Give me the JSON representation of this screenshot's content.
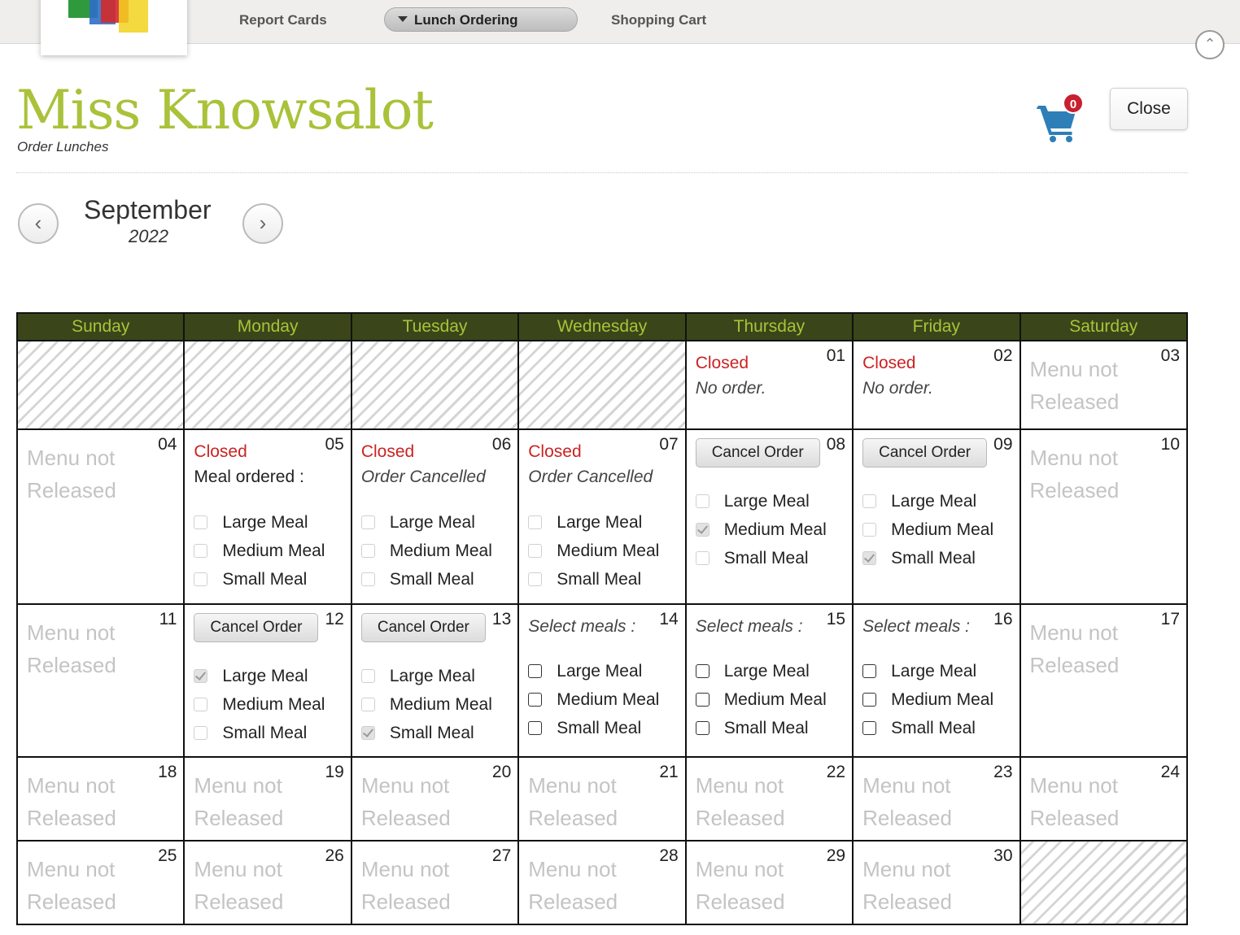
{
  "nav": {
    "report_cards": "Report Cards",
    "lunch_ordering": "Lunch Ordering",
    "shopping_cart": "Shopping Cart"
  },
  "header": {
    "title": "Miss Knowsalot",
    "subtitle": "Order Lunches",
    "cart_count": "0",
    "close_label": "Close"
  },
  "month": {
    "name": "September",
    "year": "2022"
  },
  "weekdays": [
    "Sunday",
    "Monday",
    "Tuesday",
    "Wednesday",
    "Thursday",
    "Friday",
    "Saturday"
  ],
  "labels": {
    "menu_not_released": "Menu not Released",
    "closed": "Closed",
    "no_order": "No order.",
    "meal_ordered": "Meal ordered :",
    "order_cancelled": "Order Cancelled",
    "select_meals": "Select meals :",
    "cancel_order": "Cancel Order",
    "large": "Large Meal",
    "medium": "Medium Meal",
    "small": "Small Meal"
  },
  "days": {
    "01": {
      "day": "01",
      "state": "closed",
      "note": "No order."
    },
    "02": {
      "day": "02",
      "state": "closed",
      "note": "No order."
    },
    "03": {
      "day": "03",
      "state": "not_released"
    },
    "04": {
      "day": "04",
      "state": "not_released"
    },
    "05": {
      "day": "05",
      "state": "closed_ordered",
      "note": "Meal ordered :",
      "selected": "none"
    },
    "06": {
      "day": "06",
      "state": "closed_cancelled",
      "note": "Order Cancelled"
    },
    "07": {
      "day": "07",
      "state": "closed_cancelled",
      "note": "Order Cancelled"
    },
    "08": {
      "day": "08",
      "state": "ordered",
      "selected": "Medium Meal"
    },
    "09": {
      "day": "09",
      "state": "ordered",
      "selected": "Small Meal"
    },
    "10": {
      "day": "10",
      "state": "not_released"
    },
    "11": {
      "day": "11",
      "state": "not_released"
    },
    "12": {
      "day": "12",
      "state": "ordered",
      "selected": "Large Meal"
    },
    "13": {
      "day": "13",
      "state": "ordered",
      "selected": "Small Meal"
    },
    "14": {
      "day": "14",
      "state": "open"
    },
    "15": {
      "day": "15",
      "state": "open"
    },
    "16": {
      "day": "16",
      "state": "open"
    },
    "17": {
      "day": "17",
      "state": "not_released"
    },
    "18": {
      "day": "18",
      "state": "not_released"
    },
    "19": {
      "day": "19",
      "state": "not_released"
    },
    "20": {
      "day": "20",
      "state": "not_released"
    },
    "21": {
      "day": "21",
      "state": "not_released"
    },
    "22": {
      "day": "22",
      "state": "not_released"
    },
    "23": {
      "day": "23",
      "state": "not_released"
    },
    "24": {
      "day": "24",
      "state": "not_released"
    },
    "25": {
      "day": "25",
      "state": "not_released"
    },
    "26": {
      "day": "26",
      "state": "not_released"
    },
    "27": {
      "day": "27",
      "state": "not_released"
    },
    "28": {
      "day": "28",
      "state": "not_released"
    },
    "29": {
      "day": "29",
      "state": "not_released"
    },
    "30": {
      "day": "30",
      "state": "not_released"
    }
  },
  "colors": {
    "header_bg": "#3a4619",
    "header_text": "#a9c23a",
    "title": "#a9c23a",
    "closed": "#cc2222",
    "badge": "#c8202f",
    "cart": "#2e7fb8"
  },
  "icons": [
    "logo-icon",
    "cart-icon",
    "chevron-left-icon",
    "chevron-right-icon",
    "scroll-top-icon",
    "dropdown-triangle-icon"
  ]
}
